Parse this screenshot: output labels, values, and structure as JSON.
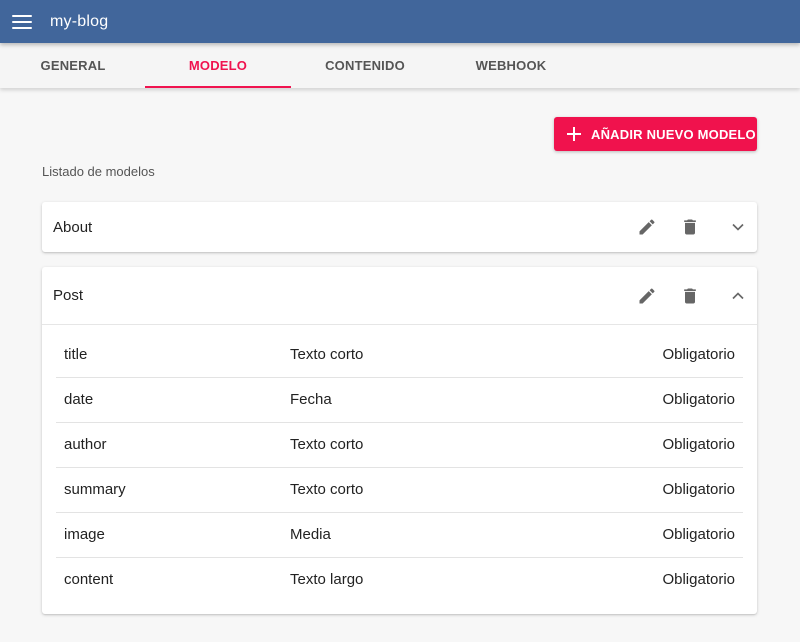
{
  "app": {
    "title": "my-blog"
  },
  "tabs": [
    {
      "label": "GENERAL",
      "active": false
    },
    {
      "label": "MODELO",
      "active": true
    },
    {
      "label": "CONTENIDO",
      "active": false
    },
    {
      "label": "WEBHOOK",
      "active": false
    }
  ],
  "actions": {
    "add_model_label": "AÑADIR NUEVO MODELO"
  },
  "list": {
    "caption": "Listado de modelos"
  },
  "models": [
    {
      "name": "About",
      "expanded": false
    },
    {
      "name": "Post",
      "expanded": true,
      "fields": [
        {
          "name": "title",
          "type": "Texto corto",
          "requirement": "Obligatorio"
        },
        {
          "name": "date",
          "type": "Fecha",
          "requirement": "Obligatorio"
        },
        {
          "name": "author",
          "type": "Texto corto",
          "requirement": "Obligatorio"
        },
        {
          "name": "summary",
          "type": "Texto corto",
          "requirement": "Obligatorio"
        },
        {
          "name": "image",
          "type": "Media",
          "requirement": "Obligatorio"
        },
        {
          "name": "content",
          "type": "Texto largo",
          "requirement": "Obligatorio"
        }
      ]
    }
  ],
  "icons": {
    "menu": "menu-icon",
    "add": "plus-icon",
    "edit": "pencil-icon",
    "delete": "trash-icon",
    "collapse": "chevron-up-icon",
    "expand": "chevron-down-icon"
  },
  "colors": {
    "appbar": "#41669b",
    "accent": "#f0134f",
    "background": "#f7f7f7"
  }
}
